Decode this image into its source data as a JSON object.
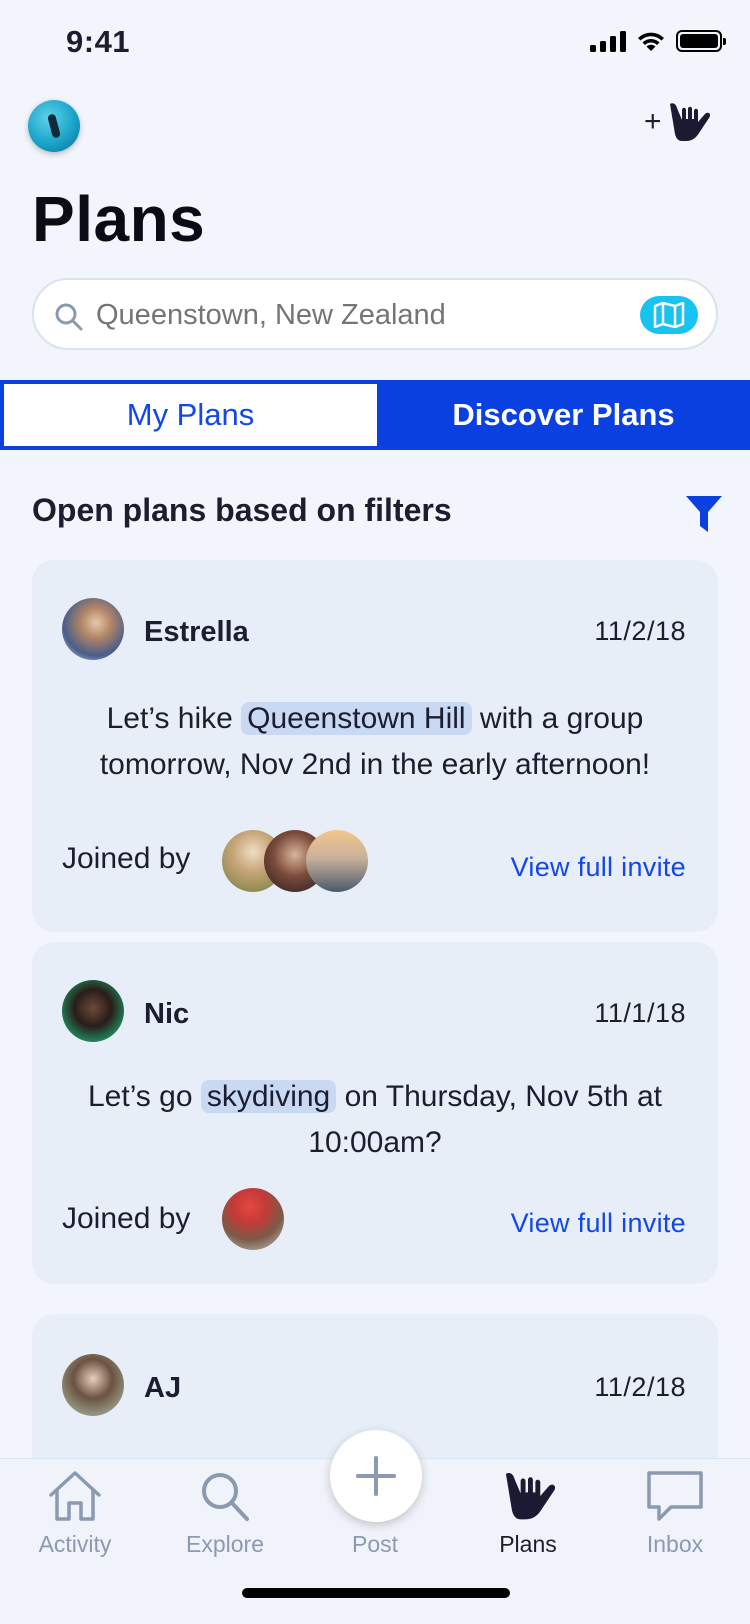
{
  "status_bar": {
    "time": "9:41"
  },
  "header": {
    "title": "Plans"
  },
  "search": {
    "value": "Queenstown, New Zealand",
    "placeholder": "Queenstown, New Zealand"
  },
  "tabs": [
    {
      "label": "My Plans",
      "active": true
    },
    {
      "label": "Discover Plans",
      "active": false
    }
  ],
  "section": {
    "title": "Open plans based on filters"
  },
  "plans": [
    {
      "name": "Estrella",
      "date": "11/2/18",
      "message_before": "Let’s hike ",
      "message_highlight": "Queenstown Hill",
      "message_after": " with a group tomorrow, Nov 2nd in the early afternoon!",
      "joined_label": "Joined by",
      "link": "View full invite"
    },
    {
      "name": "Nic",
      "date": "11/1/18",
      "message_before": "Let’s go ",
      "message_highlight": "skydiving",
      "message_after": " on Thursday, Nov 5th at 10:00am?",
      "joined_label": "Joined by",
      "link": "View full invite"
    },
    {
      "name": "AJ",
      "date": "11/2/18"
    }
  ],
  "bottom_nav": {
    "items": [
      {
        "label": "Activity",
        "icon": "home-icon",
        "active": false
      },
      {
        "label": "Explore",
        "icon": "search-icon",
        "active": false
      },
      {
        "label": "Post",
        "icon": "plus-icon",
        "active": false
      },
      {
        "label": "Plans",
        "icon": "shaka-hand-icon",
        "active": true
      },
      {
        "label": "Inbox",
        "icon": "chat-bubble-icon",
        "active": false
      }
    ]
  },
  "colors": {
    "accent": "#1347e6",
    "tab_bar": "#0a3fe0",
    "map_button": "#18c4ef",
    "card_bg": "#e8eef8",
    "highlight": "#c9d8f3"
  }
}
